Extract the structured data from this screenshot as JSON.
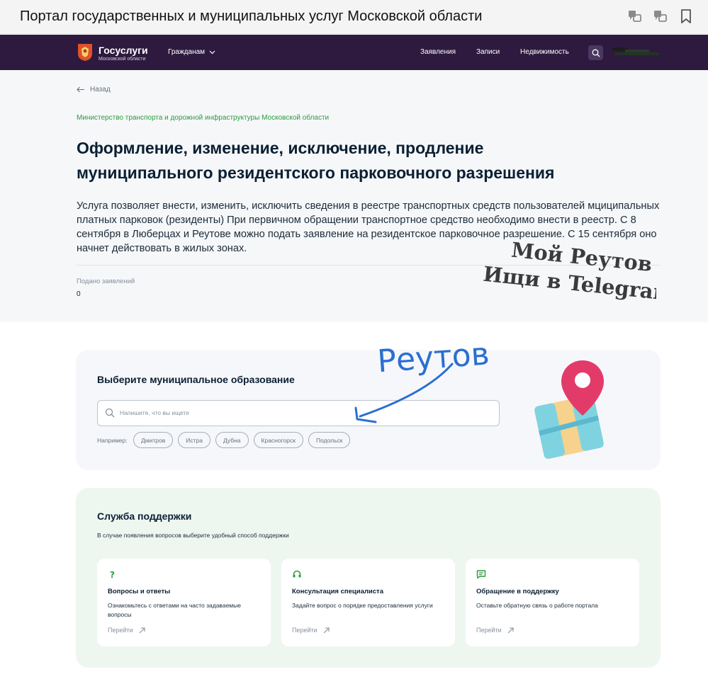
{
  "browser": {
    "title": "Портал государственных и муниципальных услуг Московской области",
    "icons": [
      "translate-icon",
      "translate-icon",
      "bookmark-icon"
    ]
  },
  "nav": {
    "logo_title": "Госуслуги",
    "logo_sub": "Московской области",
    "citizens": "Гражданам",
    "links": [
      "Заявления",
      "Записи",
      "Недвижимость"
    ]
  },
  "hero": {
    "back": "Назад",
    "ministry": "Министерство транспорта и дорожной инфраструктуры Московской области",
    "title_line1": "Оформление, изменение, исключение, продление",
    "title_line2": "муниципального резидентского парковочного разрешения",
    "description": "Услуга позволяет внести, изменить, исключить сведения в реестре транспортных средств пользователей мциципальных платных парковок (резиденты) При первичном обращении транспортное средство необходимо внести в реестр. С 8 сентября в Люберцах и Реутове можно подать заявление на резидентское парковочное разрешение. С 15 сентября оно начнет действовать в жилых зонах.",
    "submitted_label": "Подано заявлений",
    "submitted_value": "0"
  },
  "overlay": {
    "watermark_line1": "Мой Реутов",
    "watermark_line2": "Ищи в Telegram",
    "handwritten": "Реутов"
  },
  "municipality": {
    "title": "Выберите муниципальное образование",
    "search_placeholder": "Напишите, что вы ищете",
    "examples_label": "Например:",
    "chips": [
      "Дмитров",
      "Истра",
      "Дубна",
      "Красногорск",
      "Подольск"
    ]
  },
  "support": {
    "title": "Служба поддержки",
    "subtitle": "В случае появления вопросов выберите удобный способ поддержки",
    "cards": [
      {
        "icon": "question-icon",
        "title": "Вопросы и ответы",
        "text": "Ознакомьтесь с ответами на часто задаваемые вопросы",
        "link": "Перейти"
      },
      {
        "icon": "headset-icon",
        "title": "Консультация специалиста",
        "text": "Задайте вопрос о порядке предоставления услуги",
        "link": "Перейти"
      },
      {
        "icon": "chat-icon",
        "title": "Обращение в поддержку",
        "text": "Оставьте обратную связь о работе портала",
        "link": "Перейти"
      }
    ]
  },
  "colors": {
    "nav_bg": "#2e1a3f",
    "accent_green": "#2b9c3c",
    "hero_bg": "#f5f7f9",
    "support_bg": "#eef6f0",
    "annotation_blue": "#2a6fd1"
  }
}
